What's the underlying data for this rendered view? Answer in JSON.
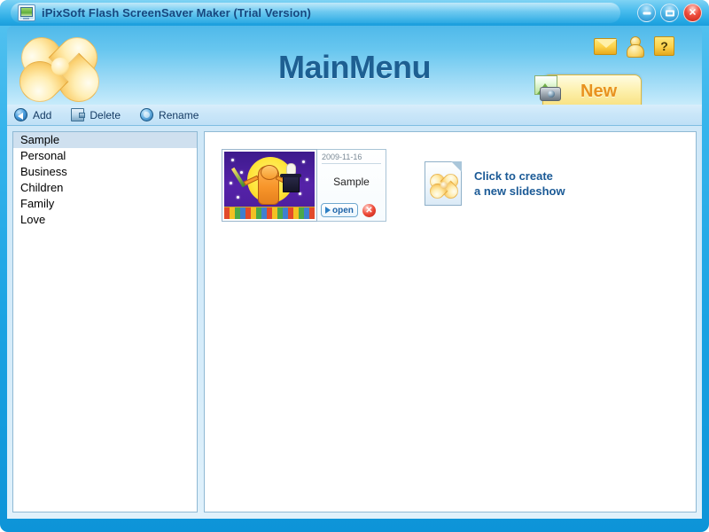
{
  "window": {
    "title": "iPixSoft Flash ScreenSaver Maker (Trial Version)",
    "app_icon": "monitor-screensaver-icon",
    "controls": {
      "minimize_label": "minimize-icon",
      "maximize_label": "maximize-icon",
      "close_label": "✕"
    }
  },
  "header": {
    "title": "MainMenu",
    "logo_icon": "clover-flower-logo",
    "icons": [
      {
        "name": "mail-icon",
        "label": ""
      },
      {
        "name": "user-icon",
        "label": ""
      },
      {
        "name": "help-icon",
        "label": "?"
      }
    ],
    "new_button": {
      "label": "New",
      "icon": "photo-camera-icon"
    }
  },
  "toolbar": {
    "items": [
      {
        "name": "add",
        "label": "Add",
        "icon": "add-arrow-icon"
      },
      {
        "name": "delete",
        "label": "Delete",
        "icon": "delete-page-icon"
      },
      {
        "name": "rename",
        "label": "Rename",
        "icon": "rename-circle-icon"
      }
    ]
  },
  "sidebar": {
    "items": [
      {
        "label": "Sample",
        "selected": true
      },
      {
        "label": "Personal",
        "selected": false
      },
      {
        "label": "Business",
        "selected": false
      },
      {
        "label": "Children",
        "selected": false
      },
      {
        "label": "Family",
        "selected": false
      },
      {
        "label": "Love",
        "selected": false
      }
    ]
  },
  "content": {
    "slideshow": {
      "date": "2009-11-16",
      "title": "Sample",
      "open_label": "open",
      "delete_label": "✕",
      "thumbnail": "cat-magician-thumbnail"
    },
    "create_new": {
      "line1": "Click to create",
      "line2": "a new slideshow",
      "icon": "new-document-clover-icon"
    }
  },
  "colors": {
    "window_blue": "#1aa3e3",
    "header_blue": "#4fb9ea",
    "title_text": "#17487f",
    "heading_text": "#1d5f92",
    "link_text": "#1b5a96",
    "new_label": "#e8921f",
    "accent_yellow": "#fbd04a",
    "close_red": "#ef4f3e",
    "selection": "#cfe0ef"
  }
}
